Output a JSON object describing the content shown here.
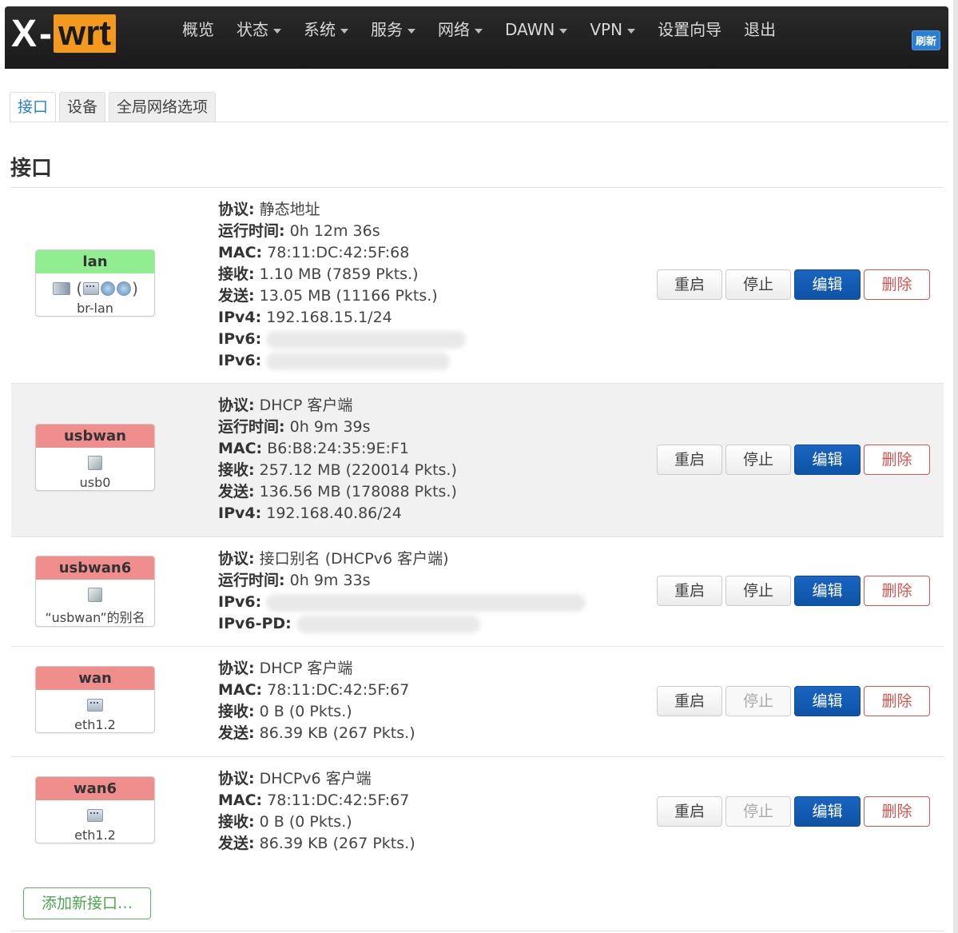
{
  "brand": {
    "x": "X",
    "dash": "-",
    "wrt": "wrt"
  },
  "menu": [
    {
      "label": "概览",
      "dropdown": false
    },
    {
      "label": "状态",
      "dropdown": true
    },
    {
      "label": "系统",
      "dropdown": true
    },
    {
      "label": "服务",
      "dropdown": true
    },
    {
      "label": "网络",
      "dropdown": true
    },
    {
      "label": "DAWN",
      "dropdown": true
    },
    {
      "label": "VPN",
      "dropdown": true
    },
    {
      "label": "设置向导",
      "dropdown": false
    },
    {
      "label": "退出",
      "dropdown": false
    }
  ],
  "refresh_label": "刷新",
  "tabs": [
    {
      "label": "接口",
      "active": true
    },
    {
      "label": "设备",
      "active": false
    },
    {
      "label": "全局网络选项",
      "active": false
    }
  ],
  "page_title": "接口",
  "buttons": {
    "reload": "重启",
    "stop": "停止",
    "edit": "编辑",
    "delete": "删除"
  },
  "add_button": "添加新接口…",
  "interfaces": [
    {
      "name": "lan",
      "status_color": "green",
      "device": "br-lan",
      "info": {
        "protocol_label": "协议:",
        "protocol": "静态地址",
        "uptime_label": "运行时间:",
        "uptime": "0h 12m 36s",
        "mac_label": "MAC:",
        "mac": "78:11:DC:42:5F:68",
        "rx_label": "接收:",
        "rx": "1.10 MB (7859 Pkts.)",
        "tx_label": "发送:",
        "tx": "13.05 MB (11166 Pkts.)",
        "ipv4_label": "IPv4:",
        "ipv4": "192.168.15.1/24",
        "ipv6_label": "IPv6:"
      },
      "stop_enabled": true
    },
    {
      "name": "usbwan",
      "status_color": "red",
      "device": "usb0",
      "info": {
        "protocol_label": "协议:",
        "protocol": "DHCP 客户端",
        "uptime_label": "运行时间:",
        "uptime": "0h 9m 39s",
        "mac_label": "MAC:",
        "mac": "B6:B8:24:35:9E:F1",
        "rx_label": "接收:",
        "rx": "257.12 MB (220014 Pkts.)",
        "tx_label": "发送:",
        "tx": "136.56 MB (178088 Pkts.)",
        "ipv4_label": "IPv4:",
        "ipv4": "192.168.40.86/24"
      },
      "stop_enabled": true
    },
    {
      "name": "usbwan6",
      "status_color": "red",
      "device": "“usbwan”的别名",
      "info": {
        "protocol_label": "协议:",
        "protocol": "接口别名 (DHCPv6 客户端)",
        "uptime_label": "运行时间:",
        "uptime": "0h 9m 33s",
        "ipv6_label": "IPv6:",
        "ipv6pd_label": "IPv6-PD:"
      },
      "stop_enabled": true
    },
    {
      "name": "wan",
      "status_color": "red",
      "device": "eth1.2",
      "info": {
        "protocol_label": "协议:",
        "protocol": "DHCP 客户端",
        "mac_label": "MAC:",
        "mac": "78:11:DC:42:5F:67",
        "rx_label": "接收:",
        "rx": "0 B (0 Pkts.)",
        "tx_label": "发送:",
        "tx": "86.39 KB (267 Pkts.)"
      },
      "stop_enabled": false
    },
    {
      "name": "wan6",
      "status_color": "red",
      "device": "eth1.2",
      "info": {
        "protocol_label": "协议:",
        "protocol": "DHCPv6 客户端",
        "mac_label": "MAC:",
        "mac": "78:11:DC:42:5F:67",
        "rx_label": "接收:",
        "rx": "0 B (0 Pkts.)",
        "tx_label": "发送:",
        "tx": "86.39 KB (267 Pkts.)"
      },
      "stop_enabled": false
    }
  ]
}
